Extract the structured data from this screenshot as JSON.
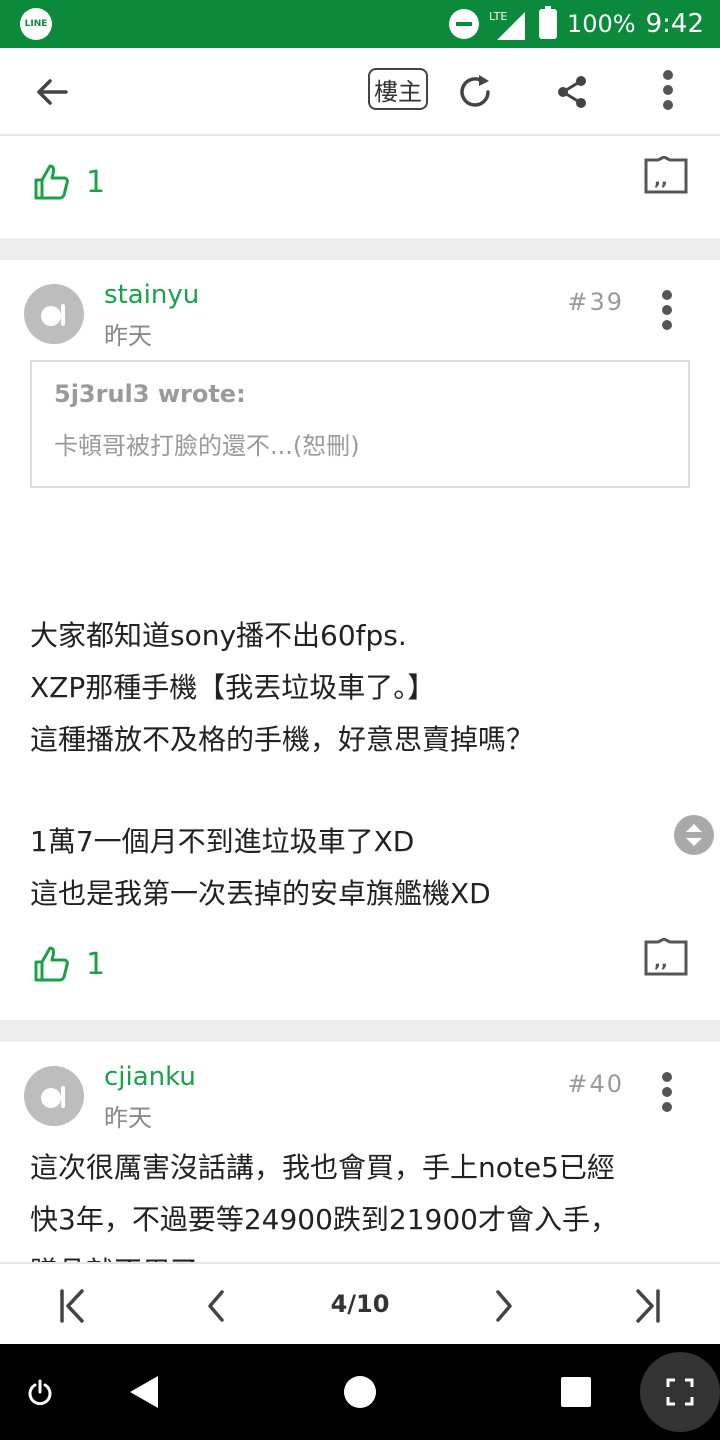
{
  "status_bar": {
    "app_icon_label": "LINE",
    "network": "LTE",
    "battery": "100%",
    "time": "9:42"
  },
  "toolbar": {
    "author_only_label": "樓主"
  },
  "prev_post": {
    "like_count": "1"
  },
  "posts": [
    {
      "username": "stainyu",
      "time": "昨天",
      "floor": "#39",
      "quote": {
        "author": "5j3rul3 wrote:",
        "text": "卡頓哥被打臉的還不...(恕刪)"
      },
      "lines": [
        "大家都知道sony播不出60fps.",
        "XZP那種手機【我丟垃圾車了。】",
        "這種播放不及格的手機，好意思賣掉嗎？",
        "1萬7一個月不到進垃圾車了XD",
        "這也是我第一次丟掉的安卓旗艦機XD"
      ],
      "like_count": "1"
    },
    {
      "username": "cjianku",
      "time": "昨天",
      "floor": "#40",
      "lines": [
        "這次很厲害沒話講，我也會買，手上note5已經",
        "快3年，不過要等24900跌到21900才會入手，",
        "贈品就不用了"
      ]
    }
  ],
  "pager": {
    "indicator": "4/10"
  },
  "colors": {
    "status_bar": "#0a8a3a",
    "accent_green": "#1aa14a"
  }
}
